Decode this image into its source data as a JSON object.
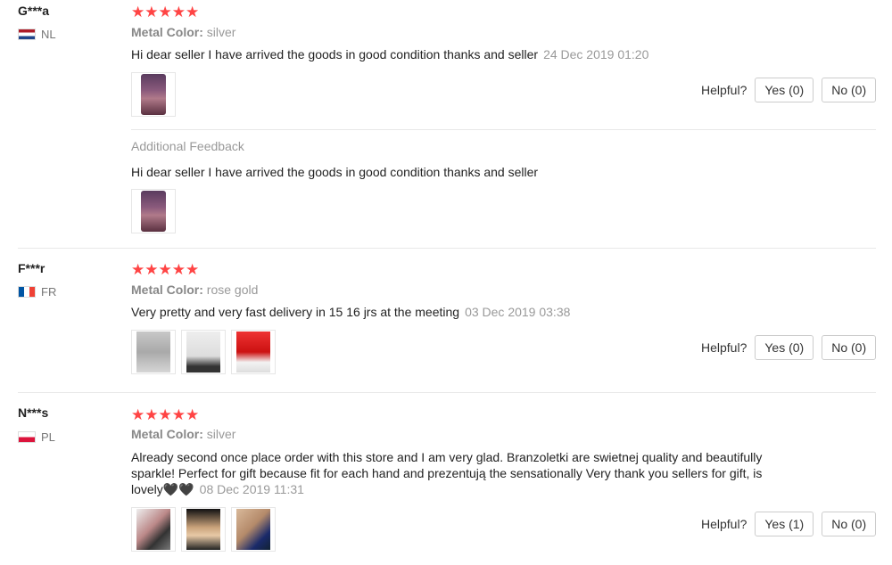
{
  "reviews": [
    {
      "user": "G***a",
      "country": "NL",
      "stars": "★★★★★",
      "attr_key": "Metal Color:",
      "attr_value": "silver",
      "text": "Hi dear seller I have arrived the goods in good condition thanks and seller",
      "date": "24 Dec 2019 01:20",
      "helpful_label": "Helpful?",
      "yes": "Yes (0)",
      "no": "No (0)",
      "additional_label": "Additional Feedback",
      "additional_text": "Hi dear seller I have arrived the goods in good condition thanks and seller"
    },
    {
      "user": "F***r",
      "country": "FR",
      "stars": "★★★★★",
      "attr_key": "Metal Color:",
      "attr_value": "rose gold",
      "text": "Very pretty and very fast delivery in 15 16 jrs at the meeting",
      "date": "03 Dec 2019 03:38",
      "helpful_label": "Helpful?",
      "yes": "Yes (0)",
      "no": "No (0)"
    },
    {
      "user": "N***s",
      "country": "PL",
      "stars": "★★★★★",
      "attr_key": "Metal Color:",
      "attr_value": "silver",
      "text_line1": "Already second once place order with this store and I am very glad. Branzoletki are swietnej quality and beautifully",
      "text_line2": "sparkle! Perfect for gift because fit for each hand and prezentują the sensationally Very thank you sellers for gift, is",
      "text_line3": "lovely🖤🖤",
      "date": "08 Dec 2019 11:31",
      "helpful_label": "Helpful?",
      "yes": "Yes (1)",
      "no": "No (0)"
    }
  ],
  "colors": {
    "star": "#ff4747",
    "muted": "#999999",
    "divider": "#e8e8e8"
  }
}
